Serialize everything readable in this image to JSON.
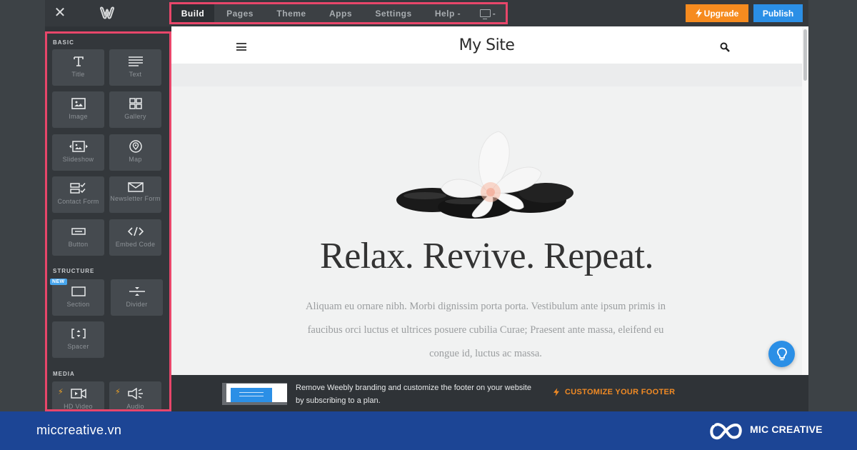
{
  "topbar": {
    "close_icon": "close-icon",
    "logo_icon": "weebly-logo-icon",
    "nav": [
      {
        "label": "Build",
        "active": true
      },
      {
        "label": "Pages",
        "active": false
      },
      {
        "label": "Theme",
        "active": false
      },
      {
        "label": "Apps",
        "active": false
      },
      {
        "label": "Settings",
        "active": false
      },
      {
        "label": "Help -",
        "active": false
      },
      {
        "label": "-",
        "icon": "monitor-icon",
        "active": false
      }
    ],
    "upgrade_label": "Upgrade",
    "publish_label": "Publish",
    "colors": {
      "upgrade": "#f68b1f",
      "publish": "#2b8fe6",
      "highlight": "#e8466a"
    }
  },
  "sidebar": {
    "sections": [
      {
        "label": "BASIC",
        "items": [
          {
            "label": "Title",
            "icon": "title-T-icon"
          },
          {
            "label": "Text",
            "icon": "text-lines-icon"
          },
          {
            "label": "Image",
            "icon": "image-icon"
          },
          {
            "label": "Gallery",
            "icon": "gallery-grid-icon"
          },
          {
            "label": "Slideshow",
            "icon": "slideshow-icon"
          },
          {
            "label": "Map",
            "icon": "map-pin-icon"
          },
          {
            "label": "Contact Form",
            "icon": "contact-form-icon"
          },
          {
            "label": "Newsletter Form",
            "icon": "envelope-icon"
          },
          {
            "label": "Button",
            "icon": "button-icon"
          },
          {
            "label": "Embed Code",
            "icon": "code-icon"
          }
        ]
      },
      {
        "label": "STRUCTURE",
        "items": [
          {
            "label": "Section",
            "icon": "section-icon",
            "badge": "NEW"
          },
          {
            "label": "Divider",
            "icon": "divider-icon"
          },
          {
            "label": "Spacer",
            "icon": "spacer-icon"
          }
        ]
      },
      {
        "label": "MEDIA",
        "items": [
          {
            "label": "HD Video",
            "icon": "video-camera-icon",
            "premium": true
          },
          {
            "label": "Audio",
            "icon": "speaker-icon",
            "premium": true
          }
        ]
      }
    ]
  },
  "site": {
    "title": "My Site",
    "headline": "Relax. Revive. Repeat.",
    "body": "Aliquam eu ornare nibh. Morbi dignissim porta porta. Vestibulum ante ipsum primis in faucibus orci luctus et ultrices posuere cubilia Curae; Praesent ante massa, eleifend eu congue id, luctus ac massa.",
    "hero_image": "frangipani flower on black stones"
  },
  "promo": {
    "text": "Remove Weebly branding and customize the footer on your website by subscribing to a plan.",
    "link_label": "CUSTOMIZE YOUR FOOTER"
  },
  "branding": {
    "url": "miccreative.vn",
    "name": "MIC CREATIVE",
    "bar_color": "#1c4595"
  }
}
